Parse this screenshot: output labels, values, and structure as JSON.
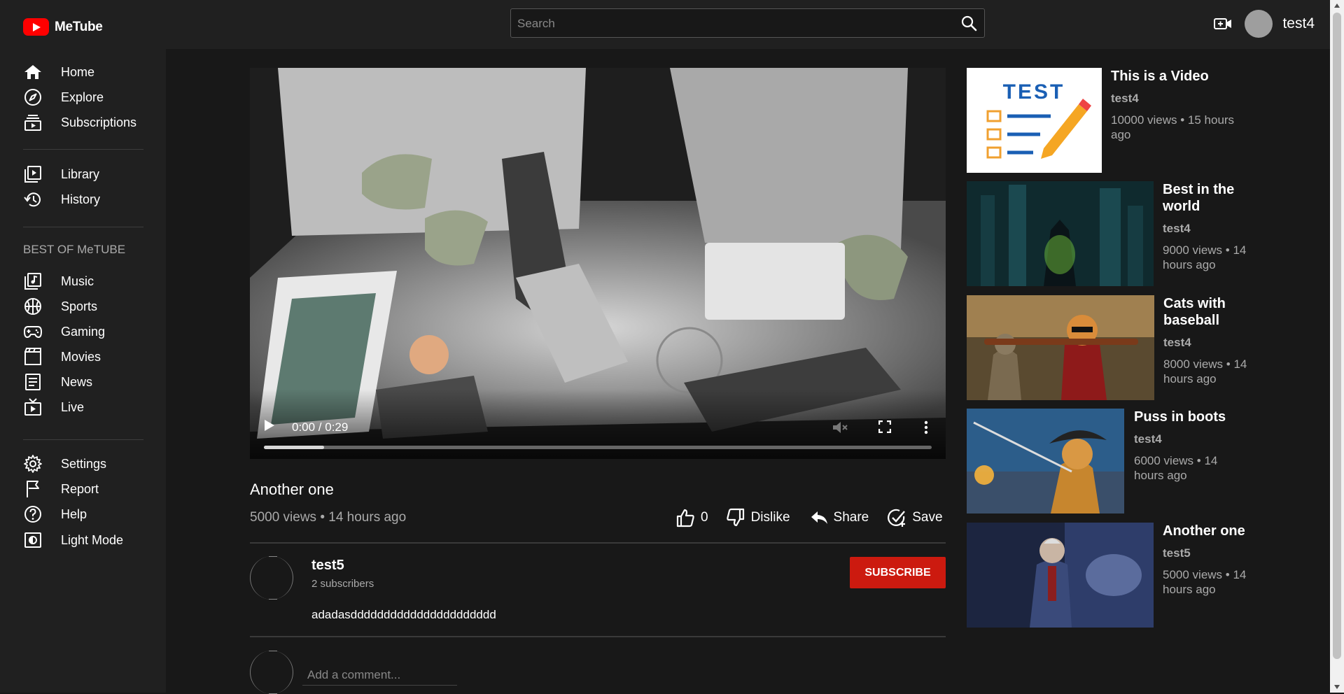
{
  "header": {
    "logo_text": "MeTube",
    "search_placeholder": "Search",
    "username": "test4"
  },
  "sidebar": {
    "group1": [
      {
        "label": "Home",
        "icon": "home-icon"
      },
      {
        "label": "Explore",
        "icon": "explore-icon"
      },
      {
        "label": "Subscriptions",
        "icon": "subscriptions-icon"
      }
    ],
    "group2": [
      {
        "label": "Library",
        "icon": "library-icon"
      },
      {
        "label": "History",
        "icon": "history-icon"
      }
    ],
    "section_title": "BEST OF MeTUBE",
    "group3": [
      {
        "label": "Music",
        "icon": "music-icon"
      },
      {
        "label": "Sports",
        "icon": "sports-icon"
      },
      {
        "label": "Gaming",
        "icon": "gaming-icon"
      },
      {
        "label": "Movies",
        "icon": "movies-icon"
      },
      {
        "label": "News",
        "icon": "news-icon"
      },
      {
        "label": "Live",
        "icon": "live-icon"
      }
    ],
    "group4": [
      {
        "label": "Settings",
        "icon": "settings-icon"
      },
      {
        "label": "Report",
        "icon": "report-icon"
      },
      {
        "label": "Help",
        "icon": "help-icon"
      },
      {
        "label": "Light Mode",
        "icon": "light-mode-icon"
      }
    ]
  },
  "player": {
    "time": "0:00 / 0:29",
    "progress": 0.09
  },
  "video": {
    "title": "Another one",
    "meta": "5000 views • 14 hours ago",
    "likes": "0",
    "dislike_label": "Dislike",
    "share_label": "Share",
    "save_label": "Save"
  },
  "channel": {
    "name": "test5",
    "subscribers": "2 subscribers",
    "subscribe_label": "SUBSCRIBE",
    "description": "adadasdddddddddddddddddddddd"
  },
  "comments": {
    "placeholder": "Add a comment..."
  },
  "recommended": [
    {
      "title": "This is a Video",
      "channel": "test4",
      "meta": "10000 views • 15 hours ago"
    },
    {
      "title": "Best in the world",
      "channel": "test4",
      "meta": "9000 views • 14 hours ago"
    },
    {
      "title": "Cats with baseball",
      "channel": "test4",
      "meta": "8000 views • 14 hours ago"
    },
    {
      "title": "Puss in boots",
      "channel": "test4",
      "meta": "6000 views • 14 hours ago"
    },
    {
      "title": "Another one",
      "channel": "test5",
      "meta": "5000 views • 14 hours ago"
    }
  ],
  "thumb_badge_text": "TEST",
  "colors": {
    "accent": "#cc1a0f",
    "logo_red": "#ff0000",
    "background": "#181818",
    "panel": "#202020"
  }
}
